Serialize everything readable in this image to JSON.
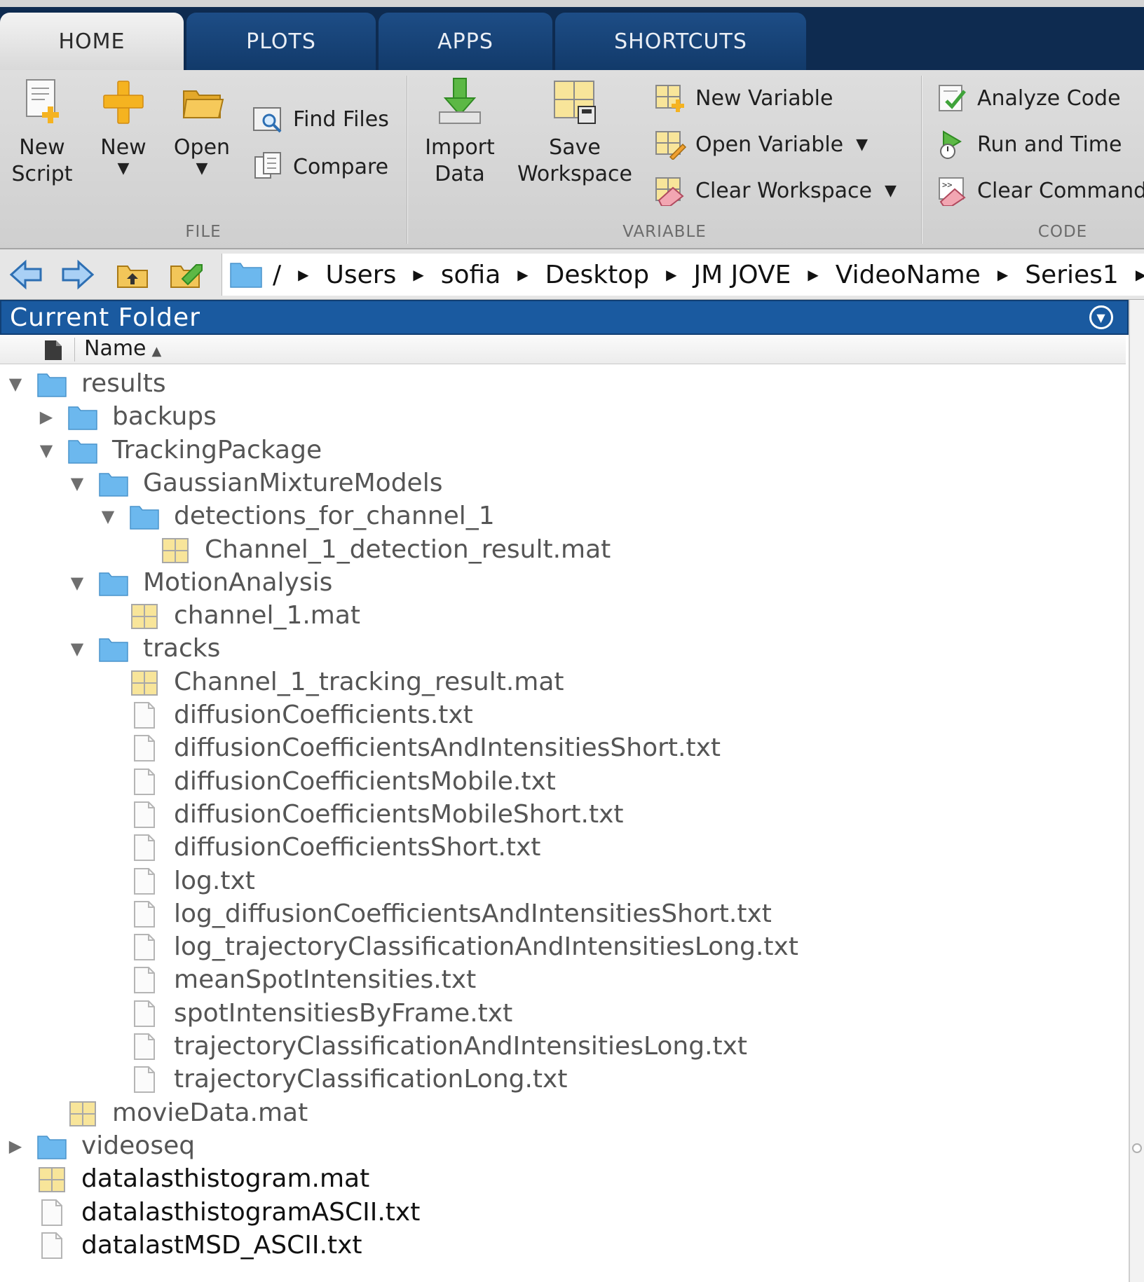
{
  "tabs": [
    {
      "label": "HOME",
      "active": true
    },
    {
      "label": "PLOTS",
      "active": false
    },
    {
      "label": "APPS",
      "active": false
    },
    {
      "label": "SHORTCUTS",
      "active": false
    }
  ],
  "ribbon": {
    "file": {
      "section_label": "FILE",
      "new_script": {
        "line1": "New",
        "line2": "Script",
        "icon": "new-script-icon"
      },
      "new": {
        "label": "New",
        "icon": "plus-icon"
      },
      "open": {
        "label": "Open",
        "icon": "open-folder-icon"
      },
      "find_files": {
        "label": "Find Files",
        "icon": "find-files-icon"
      },
      "compare": {
        "label": "Compare",
        "icon": "compare-icon"
      }
    },
    "variable": {
      "section_label": "VARIABLE",
      "import_data": {
        "line1": "Import",
        "line2": "Data",
        "icon": "import-data-icon"
      },
      "save_workspace": {
        "line1": "Save",
        "line2": "Workspace",
        "icon": "save-workspace-icon"
      },
      "new_variable": {
        "label": "New Variable",
        "icon": "new-variable-icon"
      },
      "open_variable": {
        "label": "Open Variable",
        "icon": "open-variable-icon"
      },
      "clear_workspace": {
        "label": "Clear Workspace",
        "icon": "clear-workspace-icon"
      }
    },
    "code": {
      "section_label": "CODE",
      "analyze_code": {
        "label": "Analyze Code",
        "icon": "analyze-code-icon"
      },
      "run_and_time": {
        "label": "Run and Time",
        "icon": "run-and-time-icon"
      },
      "clear_commands": {
        "label": "Clear Command",
        "icon": "clear-commands-icon"
      }
    }
  },
  "address_bar": {
    "root": "/",
    "crumbs": [
      "Users",
      "sofia",
      "Desktop",
      "JM JOVE",
      "VideoName",
      "Series1"
    ]
  },
  "panel": {
    "title": "Current Folder",
    "column_name": "Name"
  },
  "tree": [
    {
      "name": "results",
      "type": "folder",
      "depth": 0,
      "state": "expanded",
      "dim": true
    },
    {
      "name": "backups",
      "type": "folder",
      "depth": 1,
      "state": "collapsed",
      "dim": true
    },
    {
      "name": "TrackingPackage",
      "type": "folder",
      "depth": 1,
      "state": "expanded",
      "dim": true
    },
    {
      "name": "GaussianMixtureModels",
      "type": "folder",
      "depth": 2,
      "state": "expanded",
      "dim": true
    },
    {
      "name": "detections_for_channel_1",
      "type": "folder",
      "depth": 3,
      "state": "expanded",
      "dim": true
    },
    {
      "name": "Channel_1_detection_result.mat",
      "type": "mat",
      "depth": 4,
      "state": "none",
      "dim": true
    },
    {
      "name": "MotionAnalysis",
      "type": "folder",
      "depth": 2,
      "state": "expanded",
      "dim": true
    },
    {
      "name": "channel_1.mat",
      "type": "mat",
      "depth": 3,
      "state": "none",
      "dim": true
    },
    {
      "name": "tracks",
      "type": "folder",
      "depth": 2,
      "state": "expanded",
      "dim": true
    },
    {
      "name": "Channel_1_tracking_result.mat",
      "type": "mat",
      "depth": 3,
      "state": "none",
      "dim": true
    },
    {
      "name": "diffusionCoefficients.txt",
      "type": "txt",
      "depth": 3,
      "state": "none",
      "dim": true
    },
    {
      "name": "diffusionCoefficientsAndIntensitiesShort.txt",
      "type": "txt",
      "depth": 3,
      "state": "none",
      "dim": true
    },
    {
      "name": "diffusionCoefficientsMobile.txt",
      "type": "txt",
      "depth": 3,
      "state": "none",
      "dim": true
    },
    {
      "name": "diffusionCoefficientsMobileShort.txt",
      "type": "txt",
      "depth": 3,
      "state": "none",
      "dim": true
    },
    {
      "name": "diffusionCoefficientsShort.txt",
      "type": "txt",
      "depth": 3,
      "state": "none",
      "dim": true
    },
    {
      "name": "log.txt",
      "type": "txt",
      "depth": 3,
      "state": "none",
      "dim": true
    },
    {
      "name": "log_diffusionCoefficientsAndIntensitiesShort.txt",
      "type": "txt",
      "depth": 3,
      "state": "none",
      "dim": true
    },
    {
      "name": "log_trajectoryClassificationAndIntensitiesLong.txt",
      "type": "txt",
      "depth": 3,
      "state": "none",
      "dim": true
    },
    {
      "name": "meanSpotIntensities.txt",
      "type": "txt",
      "depth": 3,
      "state": "none",
      "dim": true
    },
    {
      "name": "spotIntensitiesByFrame.txt",
      "type": "txt",
      "depth": 3,
      "state": "none",
      "dim": true
    },
    {
      "name": "trajectoryClassificationAndIntensitiesLong.txt",
      "type": "txt",
      "depth": 3,
      "state": "none",
      "dim": true
    },
    {
      "name": "trajectoryClassificationLong.txt",
      "type": "txt",
      "depth": 3,
      "state": "none",
      "dim": true
    },
    {
      "name": "movieData.mat",
      "type": "mat",
      "depth": 1,
      "state": "none",
      "dim": true
    },
    {
      "name": "videoseq",
      "type": "folder",
      "depth": 0,
      "state": "collapsed",
      "dim": true
    },
    {
      "name": "datalasthistogram.mat",
      "type": "mat",
      "depth": 0,
      "state": "none",
      "dim": false
    },
    {
      "name": "datalasthistogramASCII.txt",
      "type": "txt",
      "depth": 0,
      "state": "none",
      "dim": false
    },
    {
      "name": "datalastMSD_ASCII.txt",
      "type": "txt",
      "depth": 0,
      "state": "none",
      "dim": false
    }
  ],
  "colors": {
    "tab_bar": "#0e2b50",
    "panel_header": "#1a5aa0",
    "folder": "#6cb8ee",
    "dim_text": "#555555",
    "normal_text": "#111111"
  }
}
